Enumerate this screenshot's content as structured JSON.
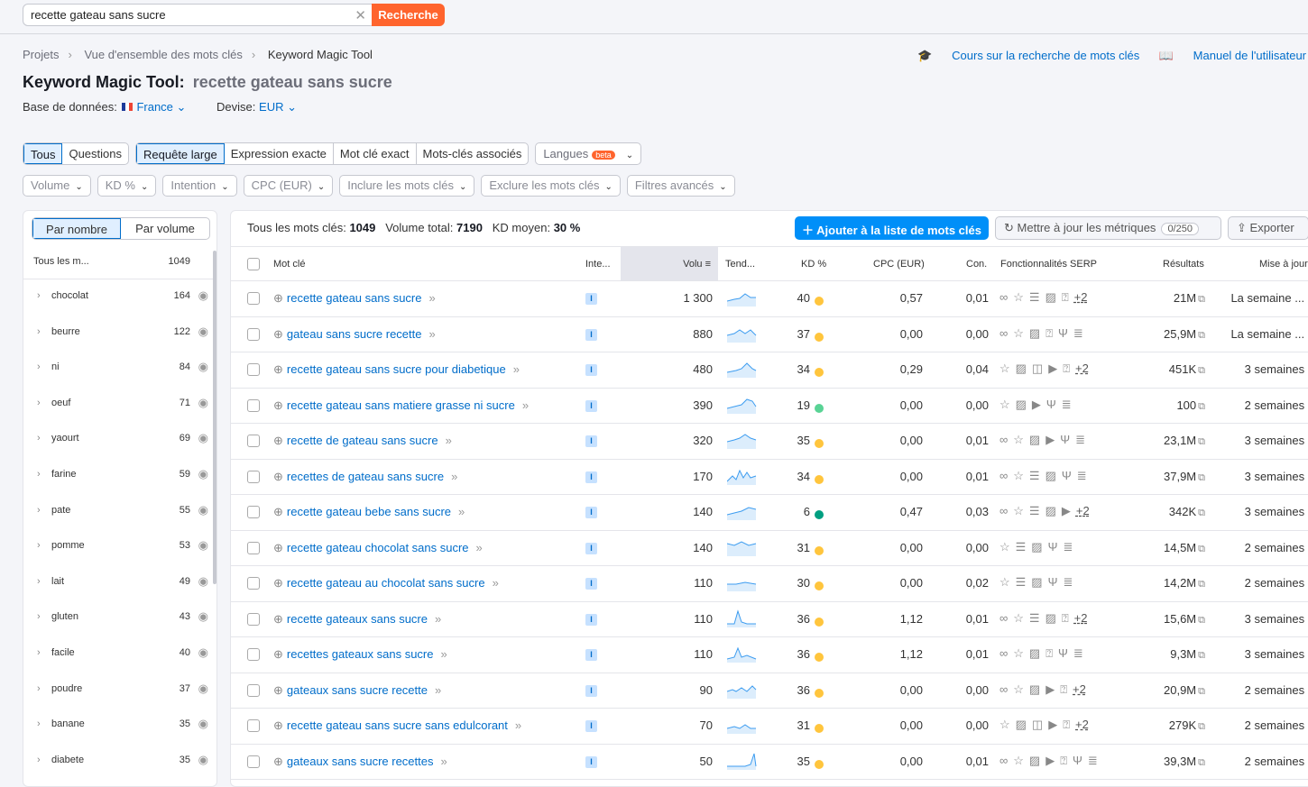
{
  "search": {
    "value": "recette gateau sans sucre",
    "button": "Recherche"
  },
  "breadcrumb": [
    "Projets",
    "Vue d'ensemble des mots clés",
    "Keyword Magic Tool"
  ],
  "links": {
    "course": "Cours sur la recherche de mots clés",
    "manual": "Manuel de l'utilisateur"
  },
  "title": {
    "tool": "Keyword Magic Tool:",
    "query": "recette gateau sans sucre"
  },
  "database": {
    "label": "Base de données:",
    "value": "France",
    "currency_label": "Devise:",
    "currency": "EUR"
  },
  "tabs1": [
    "Tous",
    "Questions"
  ],
  "tabs2": [
    "Requête large",
    "Expression exacte",
    "Mot clé exact",
    "Mots-clés associés"
  ],
  "languages": {
    "label": "Langues",
    "badge": "beta"
  },
  "filters": [
    "Volume",
    "KD %",
    "Intention",
    "CPC (EUR)",
    "Inclure les mots clés",
    "Exclure les mots clés",
    "Filtres avancés"
  ],
  "sidebar": {
    "toggle": [
      "Par nombre",
      "Par volume"
    ],
    "header": {
      "label": "Tous les m...",
      "count": "1049"
    },
    "items": [
      {
        "label": "chocolat",
        "count": "164"
      },
      {
        "label": "beurre",
        "count": "122"
      },
      {
        "label": "ni",
        "count": "84"
      },
      {
        "label": "oeuf",
        "count": "71"
      },
      {
        "label": "yaourt",
        "count": "69"
      },
      {
        "label": "farine",
        "count": "59"
      },
      {
        "label": "pate",
        "count": "55"
      },
      {
        "label": "pomme",
        "count": "53"
      },
      {
        "label": "lait",
        "count": "49"
      },
      {
        "label": "gluten",
        "count": "43"
      },
      {
        "label": "facile",
        "count": "40"
      },
      {
        "label": "poudre",
        "count": "37"
      },
      {
        "label": "banane",
        "count": "35"
      },
      {
        "label": "diabete",
        "count": "35"
      }
    ]
  },
  "stats": {
    "all_label": "Tous les mots clés:",
    "all": "1049",
    "vol_label": "Volume total:",
    "vol": "7190",
    "kd_label": "KD moyen:",
    "kd": "30 %"
  },
  "actions": {
    "add": "Ajouter à la liste de mots clés",
    "update": "Mettre à jour les métriques",
    "update_count": "0/250",
    "export": "Exporter"
  },
  "columns": [
    "Mot clé",
    "Inte...",
    "Volu",
    "Tend...",
    "KD %",
    "CPC (EUR)",
    "Con.",
    "Fonctionnalités SERP",
    "Résultats",
    "Mise à jour"
  ],
  "colors": {
    "kd_yellow": "#ffc53d",
    "kd_lightgreen": "#59d395",
    "kd_green": "#009f81",
    "accent": "#006dca",
    "brand": "#ff642d"
  },
  "rows": [
    {
      "kw": "recette gateau sans sucre",
      "intent": "I",
      "vol": "1 300",
      "kd": "40",
      "kdc": "#ffc53d",
      "cpc": "0,57",
      "con": "0,01",
      "serp": "∞☆☰▨⍰",
      "more": "+2",
      "res": "21M",
      "upd": "La semaine ..."
    },
    {
      "kw": "gateau sans sucre recette",
      "intent": "I",
      "vol": "880",
      "kd": "37",
      "kdc": "#ffc53d",
      "cpc": "0,00",
      "con": "0,00",
      "serp": "∞☆▨⍰Ψ≣",
      "more": "",
      "res": "25,9M",
      "upd": "La semaine ..."
    },
    {
      "kw": "recette gateau sans sucre pour diabetique",
      "intent": "I",
      "vol": "480",
      "kd": "34",
      "kdc": "#ffc53d",
      "cpc": "0,29",
      "con": "0,04",
      "serp": "☆▨◫▶⍰",
      "more": "+2",
      "res": "451K",
      "upd": "3 semaines"
    },
    {
      "kw": "recette gateau sans matiere grasse ni sucre",
      "intent": "I",
      "vol": "390",
      "kd": "19",
      "kdc": "#59d395",
      "cpc": "0,00",
      "con": "0,00",
      "serp": "☆▨▶Ψ≣",
      "more": "",
      "res": "100",
      "upd": "2 semaines"
    },
    {
      "kw": "recette de gateau sans sucre",
      "intent": "I",
      "vol": "320",
      "kd": "35",
      "kdc": "#ffc53d",
      "cpc": "0,00",
      "con": "0,01",
      "serp": "∞☆▨▶Ψ≣",
      "more": "",
      "res": "23,1M",
      "upd": "3 semaines"
    },
    {
      "kw": "recettes de gateau sans sucre",
      "intent": "I",
      "vol": "170",
      "kd": "34",
      "kdc": "#ffc53d",
      "cpc": "0,00",
      "con": "0,01",
      "serp": "∞☆☰▨Ψ≣",
      "more": "",
      "res": "37,9M",
      "upd": "3 semaines"
    },
    {
      "kw": "recette gateau bebe sans sucre",
      "intent": "I",
      "vol": "140",
      "kd": "6",
      "kdc": "#009f81",
      "cpc": "0,47",
      "con": "0,03",
      "serp": "∞☆☰▨▶",
      "more": "+2",
      "res": "342K",
      "upd": "3 semaines"
    },
    {
      "kw": "recette gateau chocolat sans sucre",
      "intent": "I",
      "vol": "140",
      "kd": "31",
      "kdc": "#ffc53d",
      "cpc": "0,00",
      "con": "0,00",
      "serp": "☆☰▨Ψ≣",
      "more": "",
      "res": "14,5M",
      "upd": "2 semaines"
    },
    {
      "kw": "recette gateau au chocolat sans sucre",
      "intent": "I",
      "vol": "110",
      "kd": "30",
      "kdc": "#ffc53d",
      "cpc": "0,00",
      "con": "0,02",
      "serp": "☆☰▨Ψ≣",
      "more": "",
      "res": "14,2M",
      "upd": "2 semaines"
    },
    {
      "kw": "recette gateaux sans sucre",
      "intent": "I",
      "vol": "110",
      "kd": "36",
      "kdc": "#ffc53d",
      "cpc": "1,12",
      "con": "0,01",
      "serp": "∞☆☰▨⍰",
      "more": "+2",
      "res": "15,6M",
      "upd": "3 semaines"
    },
    {
      "kw": "recettes gateaux sans sucre",
      "intent": "I",
      "vol": "110",
      "kd": "36",
      "kdc": "#ffc53d",
      "cpc": "1,12",
      "con": "0,01",
      "serp": "∞☆▨⍰Ψ≣",
      "more": "",
      "res": "9,3M",
      "upd": "3 semaines"
    },
    {
      "kw": "gateaux sans sucre recette",
      "intent": "I",
      "vol": "90",
      "kd": "36",
      "kdc": "#ffc53d",
      "cpc": "0,00",
      "con": "0,00",
      "serp": "∞☆▨▶⍰",
      "more": "+2",
      "res": "20,9M",
      "upd": "2 semaines"
    },
    {
      "kw": "recette gateau sans sucre sans edulcorant",
      "intent": "I",
      "vol": "70",
      "kd": "31",
      "kdc": "#ffc53d",
      "cpc": "0,00",
      "con": "0,00",
      "serp": "☆▨◫▶⍰",
      "more": "+2",
      "res": "279K",
      "upd": "2 semaines"
    },
    {
      "kw": "gateaux sans sucre recettes",
      "intent": "I",
      "vol": "50",
      "kd": "35",
      "kdc": "#ffc53d",
      "cpc": "0,00",
      "con": "0,01",
      "serp": "∞☆▨▶⍰Ψ≣",
      "more": "",
      "res": "39,3M",
      "upd": "2 semaines"
    }
  ]
}
